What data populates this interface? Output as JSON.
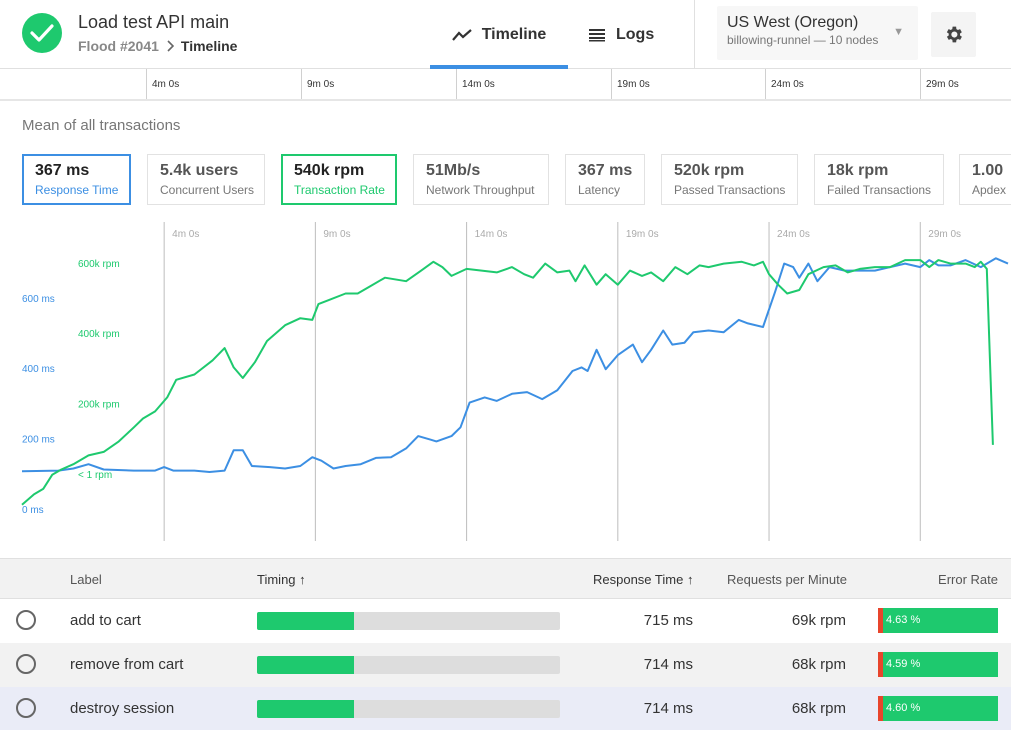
{
  "header": {
    "title": "Load test API main",
    "breadcrumb": {
      "flood": "Flood #2041",
      "current": "Timeline"
    },
    "tabs": [
      {
        "label": "Timeline",
        "icon": "timeline-chart-icon",
        "active": true
      },
      {
        "label": "Logs",
        "icon": "list-icon",
        "active": false
      }
    ],
    "region": {
      "name": "US West (Oregon)",
      "detail": "billowing-runnel — 10 nodes"
    },
    "settings_icon": "gear-icon",
    "status_icon": "check-circle-icon"
  },
  "ruler": {
    "ticks": [
      "4m 0s",
      "9m 0s",
      "14m 0s",
      "19m 0s",
      "24m 0s",
      "29m 0s"
    ]
  },
  "section_title": "Mean of all transactions",
  "metrics": [
    {
      "value": "367 ms",
      "label": "Response Time",
      "state": "active-blue"
    },
    {
      "value": "5.4k users",
      "label": "Concurrent Users",
      "state": ""
    },
    {
      "value": "540k rpm",
      "label": "Transaction Rate",
      "state": "active-green"
    },
    {
      "value": "51Mb/s",
      "label": "Network Throughput",
      "state": ""
    },
    {
      "value": "367 ms",
      "label": "Latency",
      "state": ""
    },
    {
      "value": "520k rpm",
      "label": "Passed Transactions",
      "state": ""
    },
    {
      "value": "18k rpm",
      "label": "Failed Transactions",
      "state": ""
    },
    {
      "value": "1.00",
      "label": "Apdex",
      "state": ""
    }
  ],
  "colors": {
    "blue": "#3c8fe3",
    "green": "#1ec96e",
    "red": "#e8452c"
  },
  "chart_data": {
    "type": "line",
    "x_ticks": [
      "4m 0s",
      "9m 0s",
      "14m 0s",
      "19m 0s",
      "24m 0s",
      "29m 0s"
    ],
    "x_tick_minutes": [
      4,
      9,
      14,
      19,
      24,
      29
    ],
    "x_range_minutes": [
      -0.7,
      32
    ],
    "left_axis": {
      "labels": [
        "0 ms",
        "200 ms",
        "400 ms",
        "600 ms"
      ],
      "values": [
        0,
        200,
        400,
        600
      ],
      "unit": "ms",
      "color": "#3c8fe3"
    },
    "right_axis": {
      "labels": [
        "< 1 rpm",
        "200k rpm",
        "400k rpm",
        "600k rpm"
      ],
      "values": [
        0,
        200,
        400,
        600
      ],
      "unit": "k rpm",
      "color": "#1ec96e"
    },
    "series": [
      {
        "name": "Response Time",
        "axis": "left",
        "color": "#3c8fe3",
        "points": [
          [
            -0.7,
            110
          ],
          [
            0.5,
            112
          ],
          [
            1,
            118
          ],
          [
            1.5,
            130
          ],
          [
            2,
            115
          ],
          [
            3,
            112
          ],
          [
            3.7,
            112
          ],
          [
            4,
            122
          ],
          [
            4.3,
            112
          ],
          [
            5,
            112
          ],
          [
            5.5,
            108
          ],
          [
            6,
            112
          ],
          [
            6.3,
            170
          ],
          [
            6.6,
            170
          ],
          [
            6.9,
            125
          ],
          [
            7.5,
            122
          ],
          [
            8,
            118
          ],
          [
            8.5,
            125
          ],
          [
            8.9,
            150
          ],
          [
            9.2,
            140
          ],
          [
            9.6,
            118
          ],
          [
            10,
            125
          ],
          [
            10.5,
            130
          ],
          [
            11,
            148
          ],
          [
            11.5,
            150
          ],
          [
            12,
            175
          ],
          [
            12.4,
            210
          ],
          [
            12.8,
            200
          ],
          [
            13,
            195
          ],
          [
            13.5,
            210
          ],
          [
            13.8,
            235
          ],
          [
            14.1,
            305
          ],
          [
            14.6,
            320
          ],
          [
            15,
            310
          ],
          [
            15.5,
            330
          ],
          [
            16,
            335
          ],
          [
            16.5,
            315
          ],
          [
            17,
            340
          ],
          [
            17.5,
            395
          ],
          [
            17.8,
            405
          ],
          [
            18,
            395
          ],
          [
            18.3,
            455
          ],
          [
            18.6,
            400
          ],
          [
            19,
            440
          ],
          [
            19.5,
            470
          ],
          [
            19.8,
            420
          ],
          [
            20.1,
            455
          ],
          [
            20.5,
            510
          ],
          [
            20.8,
            470
          ],
          [
            21.2,
            475
          ],
          [
            21.5,
            505
          ],
          [
            22,
            510
          ],
          [
            22.5,
            505
          ],
          [
            23,
            540
          ],
          [
            23.3,
            530
          ],
          [
            23.8,
            520
          ],
          [
            24.2,
            620
          ],
          [
            24.5,
            700
          ],
          [
            24.8,
            690
          ],
          [
            25,
            660
          ],
          [
            25.3,
            700
          ],
          [
            25.6,
            650
          ],
          [
            26,
            690
          ],
          [
            26.5,
            680
          ],
          [
            27,
            680
          ],
          [
            27.5,
            680
          ],
          [
            28,
            690
          ],
          [
            28.5,
            700
          ],
          [
            29,
            690
          ],
          [
            29.3,
            710
          ],
          [
            29.6,
            695
          ],
          [
            30,
            695
          ],
          [
            30.5,
            710
          ],
          [
            31,
            690
          ],
          [
            31.5,
            715
          ],
          [
            31.9,
            700
          ]
        ]
      },
      {
        "name": "Transaction Rate",
        "axis": "right",
        "color": "#1ec96e",
        "points": [
          [
            -0.7,
            15
          ],
          [
            -0.3,
            45
          ],
          [
            0,
            60
          ],
          [
            0.3,
            100
          ],
          [
            0.6,
            115
          ],
          [
            1,
            130
          ],
          [
            1.5,
            155
          ],
          [
            2,
            165
          ],
          [
            2.5,
            195
          ],
          [
            3,
            235
          ],
          [
            3.3,
            260
          ],
          [
            3.7,
            280
          ],
          [
            4.1,
            320
          ],
          [
            4.4,
            370
          ],
          [
            5,
            385
          ],
          [
            5.6,
            425
          ],
          [
            6,
            460
          ],
          [
            6.3,
            405
          ],
          [
            6.6,
            375
          ],
          [
            7,
            420
          ],
          [
            7.4,
            480
          ],
          [
            8,
            525
          ],
          [
            8.5,
            545
          ],
          [
            8.9,
            540
          ],
          [
            9.1,
            585
          ],
          [
            9.4,
            595
          ],
          [
            10,
            615
          ],
          [
            10.4,
            615
          ],
          [
            10.8,
            635
          ],
          [
            11.3,
            660
          ],
          [
            12,
            650
          ],
          [
            12.5,
            680
          ],
          [
            12.9,
            705
          ],
          [
            13.2,
            690
          ],
          [
            13.5,
            665
          ],
          [
            14,
            685
          ],
          [
            14.5,
            680
          ],
          [
            15,
            675
          ],
          [
            15.5,
            690
          ],
          [
            15.9,
            670
          ],
          [
            16.2,
            660
          ],
          [
            16.6,
            700
          ],
          [
            17,
            675
          ],
          [
            17.4,
            680
          ],
          [
            17.6,
            650
          ],
          [
            17.9,
            695
          ],
          [
            18.3,
            640
          ],
          [
            18.6,
            670
          ],
          [
            19,
            640
          ],
          [
            19.4,
            680
          ],
          [
            19.8,
            665
          ],
          [
            20.1,
            675
          ],
          [
            20.5,
            650
          ],
          [
            20.9,
            690
          ],
          [
            21.3,
            670
          ],
          [
            21.7,
            695
          ],
          [
            22,
            690
          ],
          [
            22.5,
            700
          ],
          [
            23.1,
            705
          ],
          [
            23.5,
            695
          ],
          [
            23.8,
            705
          ],
          [
            24,
            670
          ],
          [
            24.3,
            640
          ],
          [
            24.6,
            615
          ],
          [
            25,
            625
          ],
          [
            25.3,
            670
          ],
          [
            25.8,
            690
          ],
          [
            26.2,
            695
          ],
          [
            26.6,
            675
          ],
          [
            27,
            685
          ],
          [
            27.5,
            690
          ],
          [
            28,
            690
          ],
          [
            28.5,
            710
          ],
          [
            29,
            710
          ],
          [
            29.3,
            690
          ],
          [
            29.6,
            710
          ],
          [
            30,
            700
          ],
          [
            30.5,
            700
          ],
          [
            30.8,
            690
          ],
          [
            31,
            705
          ],
          [
            31.2,
            685
          ],
          [
            31.4,
            185
          ]
        ]
      }
    ]
  },
  "table": {
    "columns": {
      "label": "Label",
      "timing": "Timing",
      "response_time": "Response Time",
      "rpm": "Requests per Minute",
      "error_rate": "Error Rate"
    },
    "sort_arrow": "↑",
    "rows": [
      {
        "label": "add to cart",
        "timing_fraction": 0.32,
        "response_time": "715 ms",
        "rpm": "69k rpm",
        "error_rate": "4.63 %"
      },
      {
        "label": "remove from cart",
        "timing_fraction": 0.32,
        "response_time": "714 ms",
        "rpm": "68k rpm",
        "error_rate": "4.59 %"
      },
      {
        "label": "destroy session",
        "timing_fraction": 0.32,
        "response_time": "714 ms",
        "rpm": "68k rpm",
        "error_rate": "4.60 %"
      }
    ]
  }
}
